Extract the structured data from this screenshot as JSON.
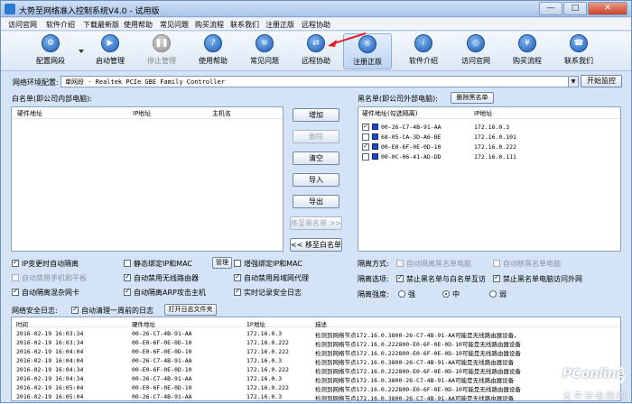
{
  "window": {
    "title": "大势至网络准入控制系统V4.0 - 试用版",
    "min": "—",
    "max": "□",
    "close": "✕"
  },
  "menu": [
    "访问官网",
    "软件介绍",
    "下载最新版",
    "使用帮助",
    "常见问题",
    "购买流程",
    "联系我们",
    "注册正版",
    "远程协助"
  ],
  "toolbar": [
    {
      "label": "配置网段",
      "icon": "gear-icon",
      "glyph": "⚙"
    },
    {
      "label": "启动管理",
      "icon": "play-icon",
      "glyph": "▶"
    },
    {
      "label": "停止管理",
      "icon": "pause-icon",
      "glyph": "❚❚"
    },
    {
      "label": "使用帮助",
      "icon": "help-book-icon",
      "glyph": "?"
    },
    {
      "label": "常见问题",
      "icon": "faq-book-icon",
      "glyph": "≡"
    },
    {
      "label": "远程协助",
      "icon": "remote-icon",
      "glyph": "⇄"
    },
    {
      "label": "注册正版",
      "icon": "register-icon",
      "glyph": "®"
    },
    {
      "label": "软件介绍",
      "icon": "gear-info-icon",
      "glyph": "i"
    },
    {
      "label": "访问官网",
      "icon": "globe-icon",
      "glyph": "◎"
    },
    {
      "label": "购买流程",
      "icon": "cart-icon",
      "glyph": "¥"
    },
    {
      "label": "联系我们",
      "icon": "contact-icon",
      "glyph": "☎"
    }
  ],
  "env": {
    "label": "网络环境配置:",
    "value": "单网段 - Realtek PCIe GBE Family Controller",
    "start_button": "开始监控"
  },
  "whitelist": {
    "title": "白名单(即公司内部电脑):",
    "columns": [
      "硬件地址",
      "IP地址",
      "主机名"
    ]
  },
  "middle_buttons": {
    "add": "增加",
    "delete": "删除",
    "clear": "清空",
    "import": "导入",
    "export": "导出",
    "move_to_black": "移至黑名单 >>",
    "move_to_white": "<< 移至白名单"
  },
  "blacklist": {
    "title": "黑名单(即公司外部电脑):",
    "delete_button": "删除黑名单",
    "columns": [
      "硬件地址(勾选隔离)",
      "IP地址"
    ],
    "rows": [
      {
        "mac": "00-26-C7-4B-91-AA",
        "ip": "172.16.0.3",
        "checked": true
      },
      {
        "mac": "68-05-CA-3D-A6-BE",
        "ip": "172.16.0.101",
        "checked": false
      },
      {
        "mac": "00-E0-6F-0E-0D-10",
        "ip": "172.16.0.222",
        "checked": true
      },
      {
        "mac": "00-0C-06-41-AD-DD",
        "ip": "172.16.0.111",
        "checked": false
      }
    ]
  },
  "left_options": {
    "ip_change_isolate": "IP变更时自动隔离",
    "auto_disable_phone": "自动禁用手机和平板",
    "auto_isolate_mixed": "自动隔离混杂网卡",
    "static_bind": "静态绑定IP和MAC",
    "manage": "管理",
    "auto_disable_wifi_router": "自动禁用无线路由器",
    "auto_isolate_arp": "自动隔离ARP攻击主机",
    "enhanced_bind": "增强绑定IP和MAC",
    "auto_disable_lan_proxy": "自动禁用局域网代理",
    "realtime_log": "实时记录安全日志"
  },
  "right_options": {
    "isolation_mode_label": "隔离方式:",
    "auto_isolate_black": "自动隔离黑名单电脑",
    "auto_move_black": "自动移黑名单电脑",
    "isolation_option_label": "隔离选项:",
    "forbid_black_white": "禁止黑名单与白名单互访",
    "forbid_black_external": "禁止黑名单电脑访问外网",
    "isolation_strength_label": "隔离强度:",
    "strong": "强",
    "medium": "中",
    "weak": "弱"
  },
  "log": {
    "title": "网络安全日志:",
    "auto_clear": "自动清理一周前的日志",
    "open_log_folder": "打开日志文件夹",
    "columns": [
      "时间",
      "硬件地址",
      "IP地址",
      "描述"
    ],
    "rows": [
      {
        "time": "2016-02-19 16:03:34",
        "mac": "00-26-C7-4B-91-AA",
        "ip": "172.16.0.3",
        "desc": "检测到网络节点172.16.0.3800-26-C7-4B-91-AA可能是无线路由器设备，"
      },
      {
        "time": "2016-02-19 16:03:34",
        "mac": "00-E0-6F-0E-0D-10",
        "ip": "172.16.0.222",
        "desc": "检测到网络节点172.16.0.222800-E0-6F-0E-0D-10可能是无线路由器设备"
      },
      {
        "time": "2016-02-19 16:04:04",
        "mac": "00-E0-6F-0E-0D-10",
        "ip": "172.16.0.222",
        "desc": "检测到网络节点172.16.0.222800-E0-6F-0E-0D-10可能是无线路由器设备"
      },
      {
        "time": "2016-02-19 16:04:04",
        "mac": "00-26-C7-4B-91-AA",
        "ip": "172.16.0.3",
        "desc": "检测到网络节点172.16.0.3800-26-C7-4B-91-AA可能是无线路由器设备"
      },
      {
        "time": "2016-02-19 16:04:34",
        "mac": "00-E0-6F-0E-0D-10",
        "ip": "172.16.0.222",
        "desc": "检测到网络节点172.16.0.222800-E0-6F-0E-0D-10可能是无线路由器设备"
      },
      {
        "time": "2016-02-19 16:04:34",
        "mac": "00-26-C7-4B-91-AA",
        "ip": "172.16.0.3",
        "desc": "检测到网络节点172.16.0.3800-26-C7-4B-91-AA可能是无线路由器设备"
      },
      {
        "time": "2016-02-19 16:05:04",
        "mac": "00-E0-6F-0E-0D-10",
        "ip": "172.16.0.222",
        "desc": "检测到网络节点172.16.0.222800-E0-6F-0E-0D-10可能是无线路由器设备"
      },
      {
        "time": "2016-02-19 16:05:04",
        "mac": "00-26-C7-4B-91-AA",
        "ip": "172.16.0.3",
        "desc": "检测到网络节点172.16.0.3800-26-C7-4B-91-AA可能是无线路由器设备"
      }
    ]
  },
  "watermark": {
    "brand": "PConline",
    "sub": "太平洋电脑网"
  }
}
